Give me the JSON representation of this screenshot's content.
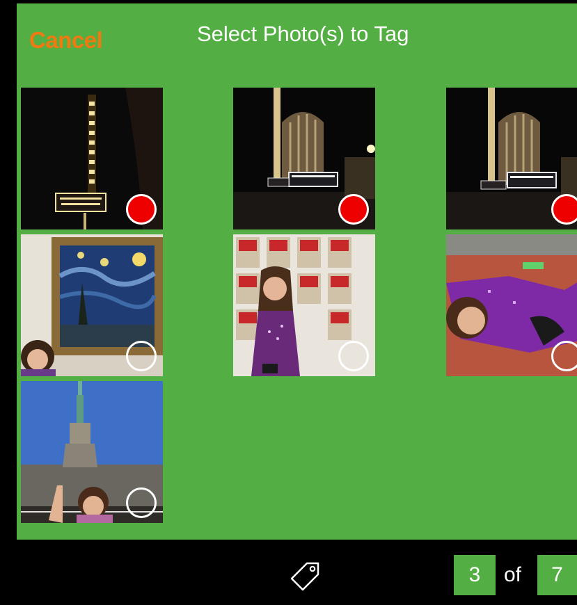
{
  "header": {
    "cancel_label": "Cancel",
    "title": "Select Photo(s) to Tag"
  },
  "photos": [
    {
      "subject": "California Theatre neon sign at night",
      "selected": true
    },
    {
      "subject": "California Theatre facade at night",
      "selected": true
    },
    {
      "subject": "California Theatre marquee at night",
      "selected": true
    },
    {
      "subject": "Girl in front of Starry Night painting",
      "selected": false
    },
    {
      "subject": "Girl in front of Campbell's soup can paintings",
      "selected": false
    },
    {
      "subject": "Girl lying on floor in purple sweater",
      "selected": false
    },
    {
      "subject": "Girl at Statue of Liberty",
      "selected": false
    }
  ],
  "footer": {
    "tag_icon": "tag-icon",
    "current": "3",
    "of_label": "of",
    "total": "7"
  },
  "colors": {
    "panel": "#53ae43",
    "cancel": "#f07a12",
    "selected": "#ee0000"
  }
}
